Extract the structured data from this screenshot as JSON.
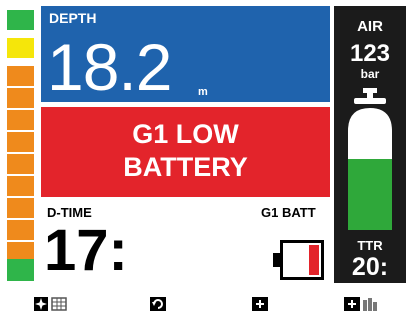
{
  "depth": {
    "label": "DEPTH",
    "value": "18.2",
    "unit": "m"
  },
  "alarm": {
    "line1": "G1 LOW",
    "line2": "BATTERY"
  },
  "dive_time": {
    "label": "D-TIME",
    "value": "17:"
  },
  "battery": {
    "label": "G1 BATT",
    "level": 0.25,
    "color": "#e3242b"
  },
  "air": {
    "label": "AIR",
    "value": "123",
    "unit": "bar"
  },
  "ttr": {
    "label": "TTR",
    "value": "20:"
  },
  "ascent_bar": {
    "segments": [
      "#2fb54a",
      "#f5e60a",
      "#ef8a1c",
      "#ef8a1c",
      "#ef8a1c",
      "#ef8a1c",
      "#ef8a1c",
      "#ef8a1c",
      "#ef8a1c",
      "#ef8a1c",
      "#ef8a1c",
      "#ef8a1c",
      "#2fb54a"
    ]
  },
  "bottom_bar": [
    "compass-gauge-icon",
    "rotate-icon",
    "plus-icon",
    "plus-chart-icon"
  ],
  "colors": {
    "depth_panel": "#1f63ad",
    "alarm_panel": "#e3242b",
    "tank_gas": "#2fa83a",
    "air_panel": "#1b1b1b"
  }
}
